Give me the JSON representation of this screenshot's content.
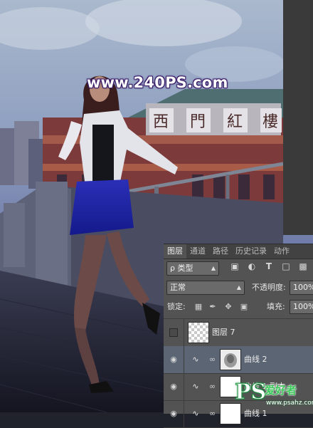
{
  "watermark": {
    "text": "www.240PS.com"
  },
  "building_sign": {
    "chars": [
      "西",
      "門",
      "紅",
      "樓"
    ]
  },
  "panel": {
    "tabs": [
      "图层",
      "通道",
      "路径",
      "历史记录",
      "动作"
    ],
    "active_tab": "图层",
    "filter": {
      "label": "ρ 类型",
      "icons": [
        "image-filter-icon",
        "adjustment-filter-icon",
        "type-filter-icon",
        "shape-filter-icon",
        "smart-object-filter-icon"
      ]
    },
    "blend_mode": "正常",
    "opacity": {
      "label": "不透明度:",
      "value": "100%"
    },
    "lock": {
      "label": "锁定:"
    },
    "fill": {
      "label": "填充:",
      "value": "100%"
    },
    "layers": [
      {
        "name": "图层 7",
        "visible": false,
        "type": "pixel",
        "selected": false
      },
      {
        "name": "曲线 2",
        "visible": true,
        "type": "curves",
        "selected": true
      },
      {
        "name": "曲线 1 副本",
        "visible": true,
        "type": "curves",
        "selected": false
      },
      {
        "name": "曲线 1",
        "visible": true,
        "type": "curves",
        "selected": false
      }
    ]
  },
  "logo": {
    "big": "PS",
    "cn": "爱好者",
    "url": "www.psahz.com"
  },
  "colors": {
    "selected_row": "#5b6573",
    "panel_bg": "#535353",
    "tab_bar": "#424242",
    "logo_green": "#3cc85a"
  }
}
